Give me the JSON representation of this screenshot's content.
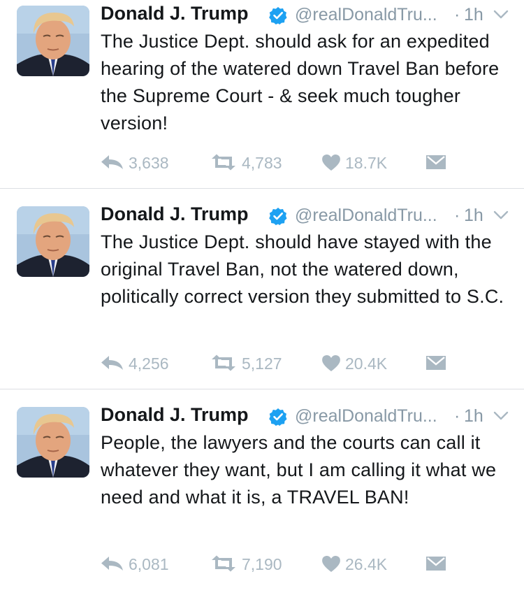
{
  "tweets": [
    {
      "name": "Donald J. Trump",
      "handle": "@realDonaldTru...",
      "dot": "·",
      "time": "1h",
      "text": "The Justice Dept. should ask for an expedited hearing of the watered down Travel Ban before the Supreme Court - & seek much tougher version!",
      "replies": "3,638",
      "retweets": "4,783",
      "likes": "18.7K"
    },
    {
      "name": "Donald J. Trump",
      "handle": "@realDonaldTru...",
      "dot": "·",
      "time": "1h",
      "text": "The Justice Dept. should have stayed with the original Travel Ban, not the watered down, politically correct version they submitted to S.C.",
      "replies": "4,256",
      "retweets": "5,127",
      "likes": "20.4K"
    },
    {
      "name": "Donald J. Trump",
      "handle": "@realDonaldTru...",
      "dot": "·",
      "time": "1h",
      "text": "People, the lawyers and the courts can call it whatever they want, but I am calling it what we need and what it is, a TRAVEL BAN!",
      "replies": "6,081",
      "retweets": "7,190",
      "likes": "26.4K"
    }
  ],
  "icons": {
    "avatar": "profile-photo",
    "verified": "verified-badge-icon",
    "caret": "chevron-down-icon",
    "reply": "reply-icon",
    "retweet": "retweet-icon",
    "like": "heart-icon",
    "dm": "direct-message-icon"
  },
  "colors": {
    "text": "#14171a",
    "muted": "#8899a6",
    "action": "#aab8c2",
    "verified": "#1da1f2",
    "divider": "#dcdfe3"
  }
}
